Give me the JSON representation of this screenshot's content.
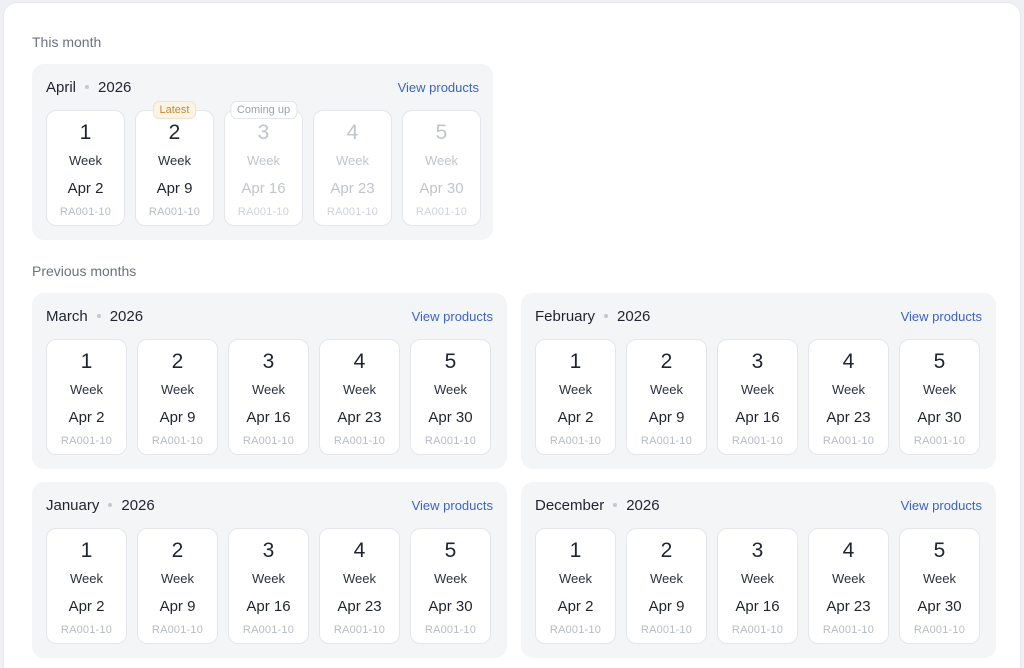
{
  "sections": {
    "this_month_label": "This month",
    "previous_months_label": "Previous months"
  },
  "colors": {
    "link": "#3b63c8",
    "latest_badge": "#c28a3c",
    "future_text": "#c0c5cd"
  },
  "current": {
    "month": "April",
    "year": "2026",
    "link": "View products",
    "weeks": [
      {
        "num": "1",
        "label": "Week",
        "date": "Apr 2",
        "code": "RA001-10",
        "state": "past",
        "badge": ""
      },
      {
        "num": "2",
        "label": "Week",
        "date": "Apr 9",
        "code": "RA001-10",
        "state": "latest",
        "badge": "Latest"
      },
      {
        "num": "3",
        "label": "Week",
        "date": "Apr 16",
        "code": "RA001-10",
        "state": "future",
        "badge": "Coming up"
      },
      {
        "num": "4",
        "label": "Week",
        "date": "Apr 23",
        "code": "RA001-10",
        "state": "future",
        "badge": ""
      },
      {
        "num": "5",
        "label": "Week",
        "date": "Apr 30",
        "code": "RA001-10",
        "state": "future",
        "badge": ""
      }
    ]
  },
  "previous": [
    {
      "month": "March",
      "year": "2026",
      "link": "View products",
      "weeks": [
        {
          "num": "1",
          "label": "Week",
          "date": "Apr 2",
          "code": "RA001-10"
        },
        {
          "num": "2",
          "label": "Week",
          "date": "Apr 9",
          "code": "RA001-10"
        },
        {
          "num": "3",
          "label": "Week",
          "date": "Apr 16",
          "code": "RA001-10"
        },
        {
          "num": "4",
          "label": "Week",
          "date": "Apr 23",
          "code": "RA001-10"
        },
        {
          "num": "5",
          "label": "Week",
          "date": "Apr 30",
          "code": "RA001-10"
        }
      ]
    },
    {
      "month": "February",
      "year": "2026",
      "link": "View products",
      "weeks": [
        {
          "num": "1",
          "label": "Week",
          "date": "Apr 2",
          "code": "RA001-10"
        },
        {
          "num": "2",
          "label": "Week",
          "date": "Apr 9",
          "code": "RA001-10"
        },
        {
          "num": "3",
          "label": "Week",
          "date": "Apr 16",
          "code": "RA001-10"
        },
        {
          "num": "4",
          "label": "Week",
          "date": "Apr 23",
          "code": "RA001-10"
        },
        {
          "num": "5",
          "label": "Week",
          "date": "Apr 30",
          "code": "RA001-10"
        }
      ]
    },
    {
      "month": "January",
      "year": "2026",
      "link": "View products",
      "weeks": [
        {
          "num": "1",
          "label": "Week",
          "date": "Apr 2",
          "code": "RA001-10"
        },
        {
          "num": "2",
          "label": "Week",
          "date": "Apr 9",
          "code": "RA001-10"
        },
        {
          "num": "3",
          "label": "Week",
          "date": "Apr 16",
          "code": "RA001-10"
        },
        {
          "num": "4",
          "label": "Week",
          "date": "Apr 23",
          "code": "RA001-10"
        },
        {
          "num": "5",
          "label": "Week",
          "date": "Apr 30",
          "code": "RA001-10"
        }
      ]
    },
    {
      "month": "December",
      "year": "2026",
      "link": "View products",
      "weeks": [
        {
          "num": "1",
          "label": "Week",
          "date": "Apr 2",
          "code": "RA001-10"
        },
        {
          "num": "2",
          "label": "Week",
          "date": "Apr 9",
          "code": "RA001-10"
        },
        {
          "num": "3",
          "label": "Week",
          "date": "Apr 16",
          "code": "RA001-10"
        },
        {
          "num": "4",
          "label": "Week",
          "date": "Apr 23",
          "code": "RA001-10"
        },
        {
          "num": "5",
          "label": "Week",
          "date": "Apr 30",
          "code": "RA001-10"
        }
      ]
    }
  ]
}
